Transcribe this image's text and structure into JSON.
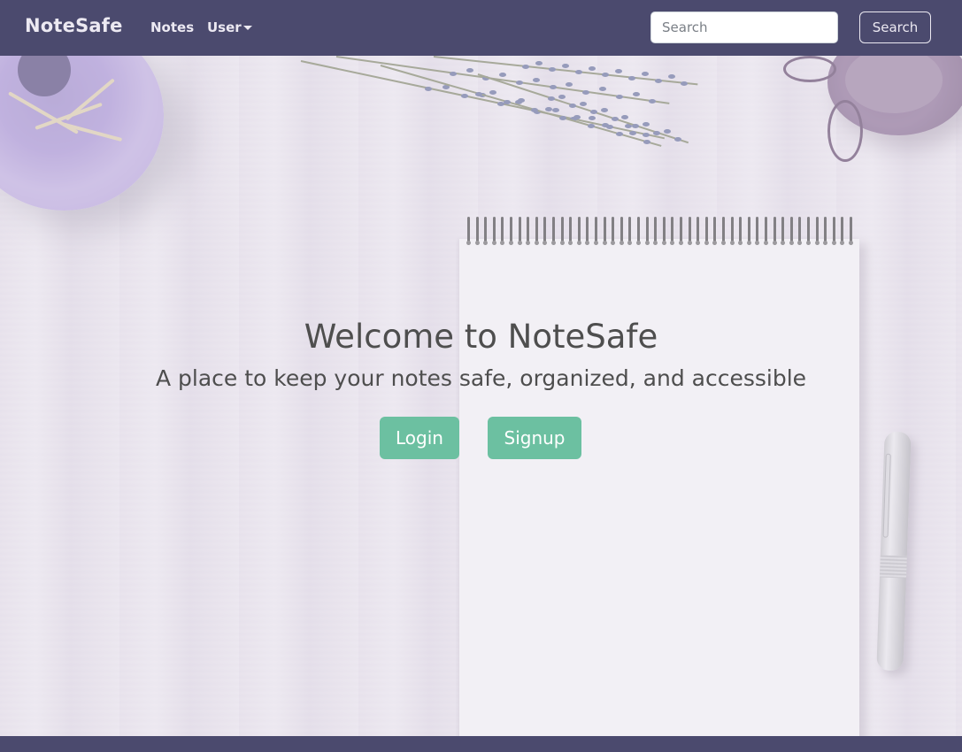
{
  "navbar": {
    "brand": "NoteSafe",
    "notes_label": "Notes",
    "user_label": "User",
    "search_placeholder": "Search",
    "search_value": "",
    "search_button": "Search"
  },
  "hero": {
    "title": "Welcome to NoteSafe",
    "subtitle": "A place to keep your notes safe, organized, and accessible",
    "login_label": "Login",
    "signup_label": "Signup"
  },
  "colors": {
    "navbar": "#4b4a6e",
    "accent_button": "#6cc0a1",
    "text": "#4e4e4e",
    "nav_text": "#ece9f2"
  },
  "icons": {
    "user_dropdown": "chevron-down-icon"
  }
}
